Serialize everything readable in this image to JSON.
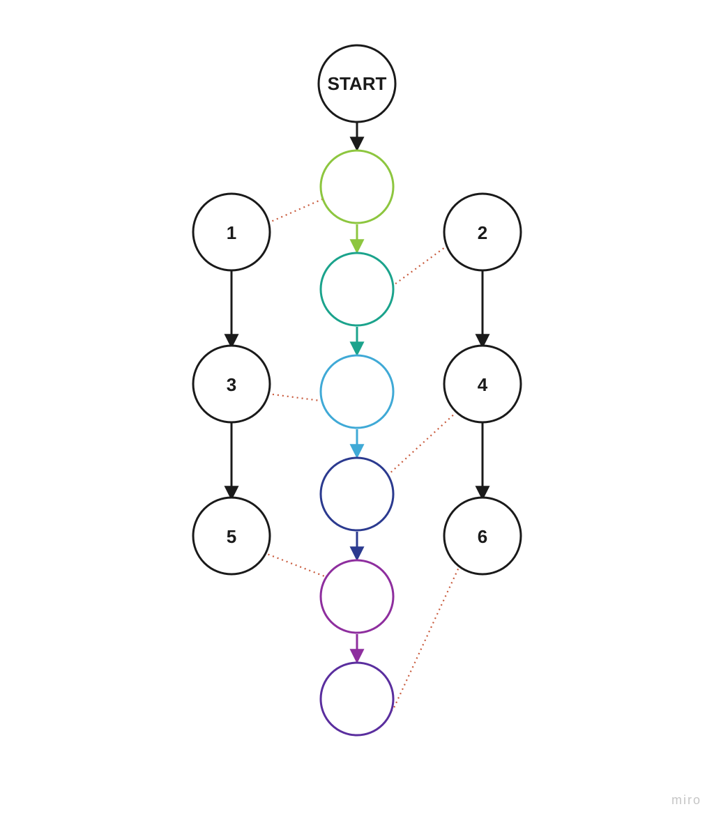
{
  "watermark": "miro",
  "colors": {
    "black": "#1a1a1a",
    "dotted": "#c85a3c",
    "green": "#8dc63f",
    "teal": "#1ba38c",
    "cyan": "#3fa9d6",
    "blue": "#2b3a8f",
    "purple": "#8e2e9e",
    "violet": "#5a2e9e"
  },
  "nodes": {
    "start": {
      "label": "START"
    },
    "n1": {
      "label": "1"
    },
    "n2": {
      "label": "2"
    },
    "n3": {
      "label": "3"
    },
    "n4": {
      "label": "4"
    },
    "n5": {
      "label": "5"
    },
    "n6": {
      "label": "6"
    },
    "c1": {
      "label": ""
    },
    "c2": {
      "label": ""
    },
    "c3": {
      "label": ""
    },
    "c4": {
      "label": ""
    },
    "c5": {
      "label": ""
    },
    "c6": {
      "label": ""
    }
  },
  "chart_data": {
    "type": "flowchart",
    "nodes": [
      {
        "id": "start",
        "label": "START",
        "shape": "circle",
        "stroke": "black"
      },
      {
        "id": "c1",
        "label": "",
        "shape": "circle",
        "stroke": "green"
      },
      {
        "id": "c2",
        "label": "",
        "shape": "circle",
        "stroke": "teal"
      },
      {
        "id": "c3",
        "label": "",
        "shape": "circle",
        "stroke": "cyan"
      },
      {
        "id": "c4",
        "label": "",
        "shape": "circle",
        "stroke": "blue"
      },
      {
        "id": "c5",
        "label": "",
        "shape": "circle",
        "stroke": "purple"
      },
      {
        "id": "c6",
        "label": "",
        "shape": "circle",
        "stroke": "violet"
      },
      {
        "id": "n1",
        "label": "1",
        "shape": "circle",
        "stroke": "black"
      },
      {
        "id": "n2",
        "label": "2",
        "shape": "circle",
        "stroke": "black"
      },
      {
        "id": "n3",
        "label": "3",
        "shape": "circle",
        "stroke": "black"
      },
      {
        "id": "n4",
        "label": "4",
        "shape": "circle",
        "stroke": "black"
      },
      {
        "id": "n5",
        "label": "5",
        "shape": "circle",
        "stroke": "black"
      },
      {
        "id": "n6",
        "label": "6",
        "shape": "circle",
        "stroke": "black"
      }
    ],
    "edges": [
      {
        "from": "start",
        "to": "c1",
        "style": "arrow",
        "color": "black"
      },
      {
        "from": "c1",
        "to": "c2",
        "style": "arrow",
        "color": "green"
      },
      {
        "from": "c2",
        "to": "c3",
        "style": "arrow",
        "color": "teal"
      },
      {
        "from": "c3",
        "to": "c4",
        "style": "arrow",
        "color": "cyan"
      },
      {
        "from": "c4",
        "to": "c5",
        "style": "arrow",
        "color": "blue"
      },
      {
        "from": "c5",
        "to": "c6",
        "style": "arrow",
        "color": "purple"
      },
      {
        "from": "n1",
        "to": "n3",
        "style": "arrow",
        "color": "black"
      },
      {
        "from": "n3",
        "to": "n5",
        "style": "arrow",
        "color": "black"
      },
      {
        "from": "n2",
        "to": "n4",
        "style": "arrow",
        "color": "black"
      },
      {
        "from": "n4",
        "to": "n6",
        "style": "arrow",
        "color": "black"
      },
      {
        "from": "n1",
        "to": "c1",
        "style": "dotted",
        "color": "dotted"
      },
      {
        "from": "n2",
        "to": "c2",
        "style": "dotted",
        "color": "dotted"
      },
      {
        "from": "n3",
        "to": "c3",
        "style": "dotted",
        "color": "dotted"
      },
      {
        "from": "n4",
        "to": "c4",
        "style": "dotted",
        "color": "dotted"
      },
      {
        "from": "n5",
        "to": "c5",
        "style": "dotted",
        "color": "dotted"
      },
      {
        "from": "n6",
        "to": "c6",
        "style": "dotted",
        "color": "dotted"
      }
    ]
  }
}
